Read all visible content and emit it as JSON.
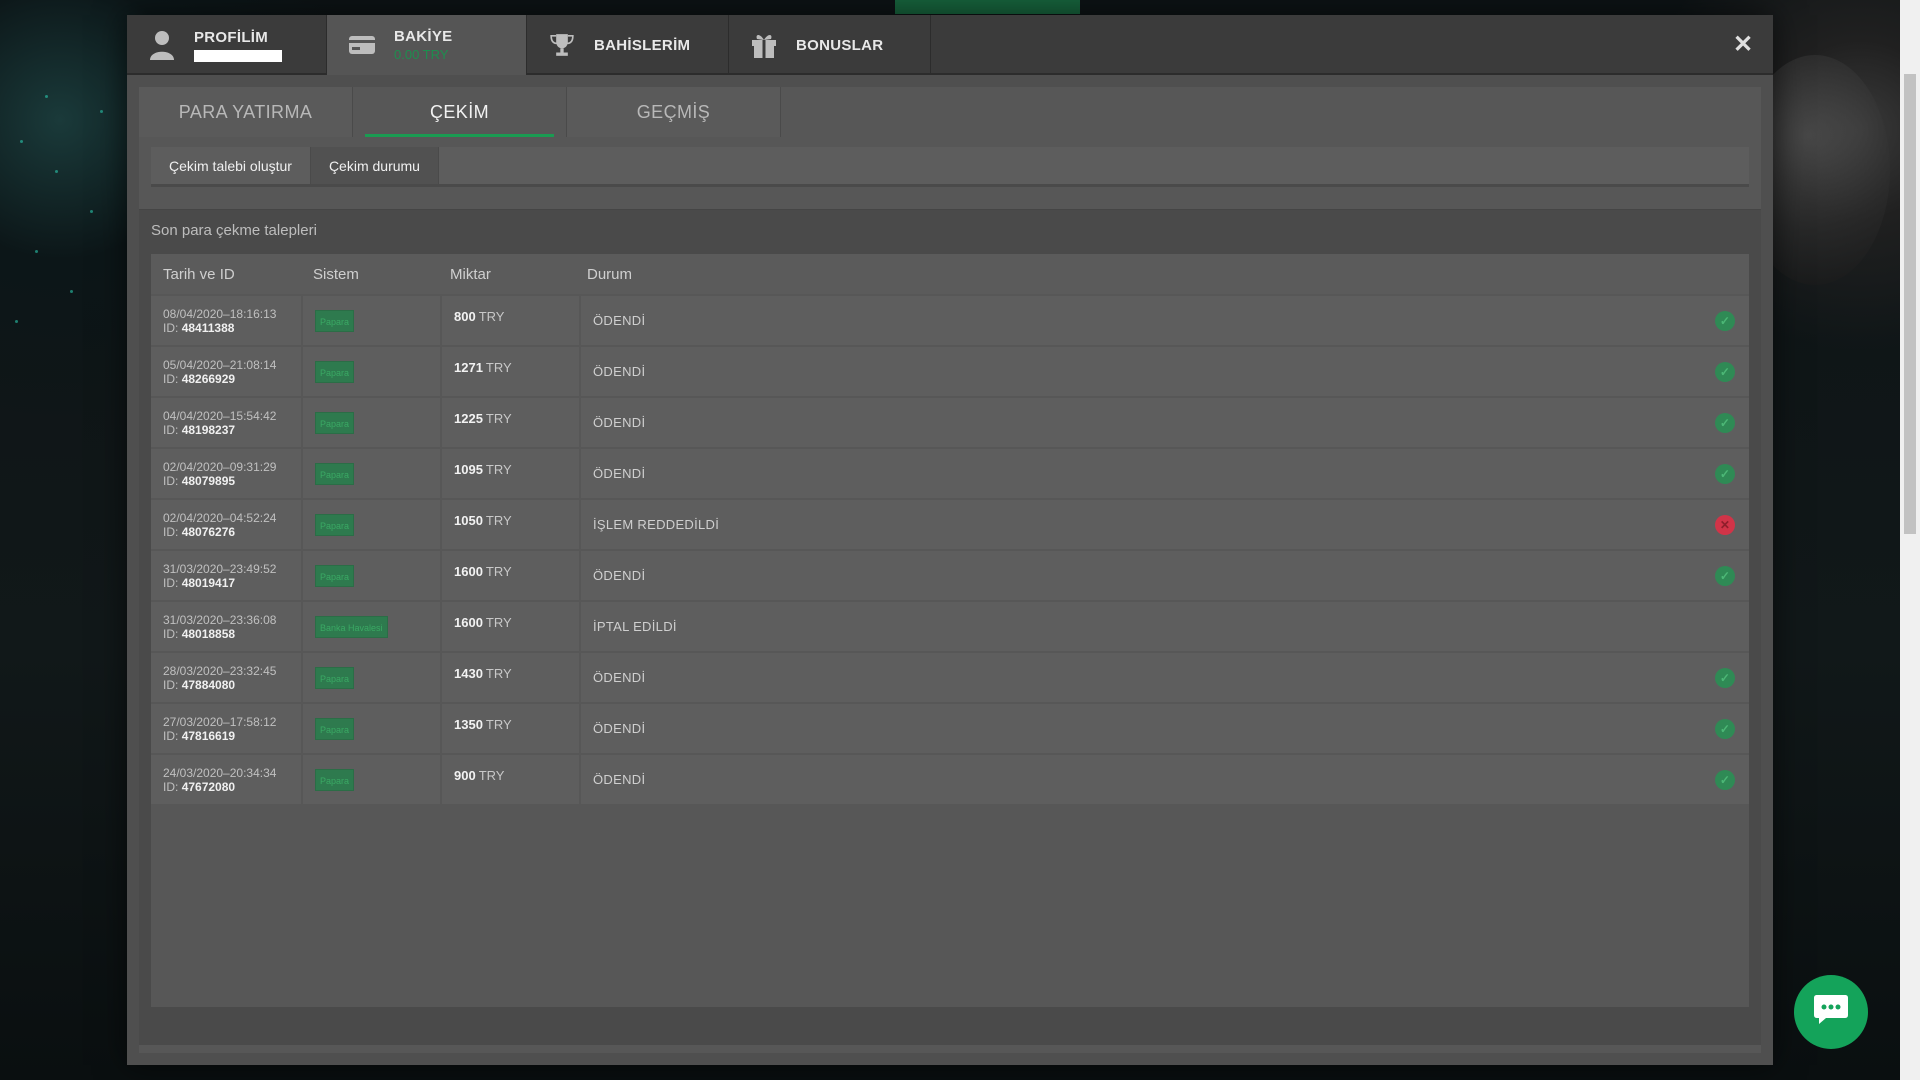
{
  "header": {
    "profile_label": "PROFİLİM",
    "balance_label": "BAKİYE",
    "balance_value": "0.00 TRY",
    "bets_label": "BAHİSLERİM",
    "bonuses_label": "BONUSLAR",
    "close_symbol": "✕"
  },
  "main_tabs": [
    "PARA YATIRMA",
    "ÇEKİM",
    "GEÇMİŞ"
  ],
  "sub_tabs": [
    "Çekim talebi oluştur",
    "Çekim durumu"
  ],
  "section_title": "Son para çekme talepleri",
  "table": {
    "headers": [
      "Tarih ve ID",
      "Sistem",
      "Miktar",
      "Durum"
    ],
    "rows": [
      {
        "date": "08/04/2020–18:16:13",
        "id_prefix": "ID:",
        "id": "48411388",
        "system": "Papara",
        "amount": "800",
        "currency": "TRY",
        "status": "ÖDENDİ",
        "status_type": "ok"
      },
      {
        "date": "05/04/2020–21:08:14",
        "id_prefix": "ID:",
        "id": "48266929",
        "system": "Papara",
        "amount": "1271",
        "currency": "TRY",
        "status": "ÖDENDİ",
        "status_type": "ok"
      },
      {
        "date": "04/04/2020–15:54:42",
        "id_prefix": "ID:",
        "id": "48198237",
        "system": "Papara",
        "amount": "1225",
        "currency": "TRY",
        "status": "ÖDENDİ",
        "status_type": "ok"
      },
      {
        "date": "02/04/2020–09:31:29",
        "id_prefix": "ID:",
        "id": "48079895",
        "system": "Papara",
        "amount": "1095",
        "currency": "TRY",
        "status": "ÖDENDİ",
        "status_type": "ok"
      },
      {
        "date": "02/04/2020–04:52:24",
        "id_prefix": "ID:",
        "id": "48076276",
        "system": "Papara",
        "amount": "1050",
        "currency": "TRY",
        "status": "İŞLEM REDDEDİLDİ",
        "status_type": "bad"
      },
      {
        "date": "31/03/2020–23:49:52",
        "id_prefix": "ID:",
        "id": "48019417",
        "system": "Papara",
        "amount": "1600",
        "currency": "TRY",
        "status": "ÖDENDİ",
        "status_type": "ok"
      },
      {
        "date": "31/03/2020–23:36:08",
        "id_prefix": "ID:",
        "id": "48018858",
        "system": "Banka Havalesi",
        "amount": "1600",
        "currency": "TRY",
        "status": "İPTAL EDİLDİ",
        "status_type": "none"
      },
      {
        "date": "28/03/2020–23:32:45",
        "id_prefix": "ID:",
        "id": "47884080",
        "system": "Papara",
        "amount": "1430",
        "currency": "TRY",
        "status": "ÖDENDİ",
        "status_type": "ok"
      },
      {
        "date": "27/03/2020–17:58:12",
        "id_prefix": "ID:",
        "id": "47816619",
        "system": "Papara",
        "amount": "1350",
        "currency": "TRY",
        "status": "ÖDENDİ",
        "status_type": "ok"
      },
      {
        "date": "24/03/2020–20:34:34",
        "id_prefix": "ID:",
        "id": "47672080",
        "system": "Papara",
        "amount": "900",
        "currency": "TRY",
        "status": "ÖDENDİ",
        "status_type": "ok"
      }
    ]
  },
  "colors": {
    "accent_green": "#1a9b52",
    "status_ok": "#2f8a55",
    "status_bad": "#d13448"
  },
  "icons": {
    "profile": "user-icon",
    "balance": "wallet-icon",
    "bets": "trophy-icon",
    "bonuses": "gift-icon",
    "chat": "chat-bubble-icon"
  }
}
